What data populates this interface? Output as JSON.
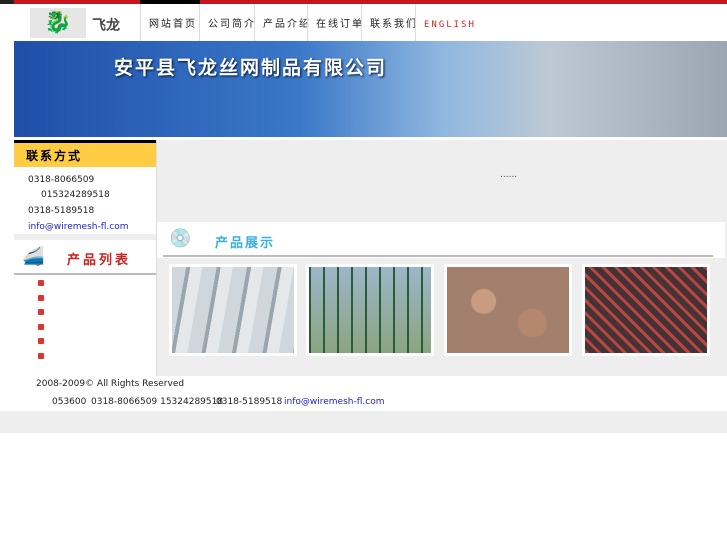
{
  "header": {
    "logo_text": "飞龙",
    "nav": [
      "网站首页",
      "公司简介",
      "产品介绍",
      "在线订单",
      "联系我们",
      "ENGLISH"
    ]
  },
  "banner": {
    "company_name": "安平县飞龙丝网制品有限公司"
  },
  "contact": {
    "title": "联系方式",
    "phone1": "0318-8066509",
    "mobile": "015324289518",
    "phone2": "0318-5189518",
    "email": "info@wiremesh-fl.com"
  },
  "product_list": {
    "title": "产品列表"
  },
  "main": {
    "notice": "......",
    "showcase_title": "产品展示"
  },
  "footer": {
    "copyright": "2008-2009©    All Rights Reserved",
    "postcode": "053600",
    "phones": "0318-8066509 15324289518",
    "fax": "0318-5189518",
    "email": "info@wiremesh-fl.com"
  },
  "colors": {
    "accent": "#c8161d",
    "sidebar_heading": "#ffcc44"
  }
}
